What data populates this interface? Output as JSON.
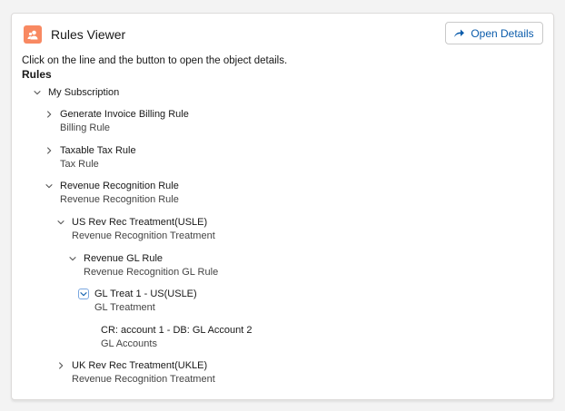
{
  "header": {
    "title": "Rules Viewer",
    "icon": "user-group-icon",
    "button_label": "Open Details",
    "accent": "#f88962"
  },
  "description": "Click on the line and the button to open the object details.",
  "section_label": "Rules",
  "tree": [
    {
      "title": "My Subscription",
      "expanded": true
    },
    {
      "title": "Generate Invoice Billing Rule",
      "subtitle": "Billing Rule",
      "expanded": false
    },
    {
      "title": "Taxable Tax Rule",
      "subtitle": "Tax Rule",
      "expanded": false
    },
    {
      "title": "Revenue Recognition Rule",
      "subtitle": "Revenue Recognition Rule",
      "expanded": true
    },
    {
      "title": "US Rev Rec Treatment(USLE)",
      "subtitle": "Revenue Recognition Treatment",
      "expanded": true
    },
    {
      "title": "Revenue GL Rule",
      "subtitle": "Revenue Recognition GL Rule",
      "expanded": true
    },
    {
      "title": "GL Treat 1 - US(USLE)",
      "subtitle": "GL Treatment",
      "expanded": true,
      "selected": true
    },
    {
      "title": "CR: account 1 - DB: GL Account 2",
      "subtitle": "GL Accounts"
    },
    {
      "title": "UK Rev Rec Treatment(UKLE)",
      "subtitle": "Revenue Recognition Treatment",
      "expanded": false
    }
  ]
}
